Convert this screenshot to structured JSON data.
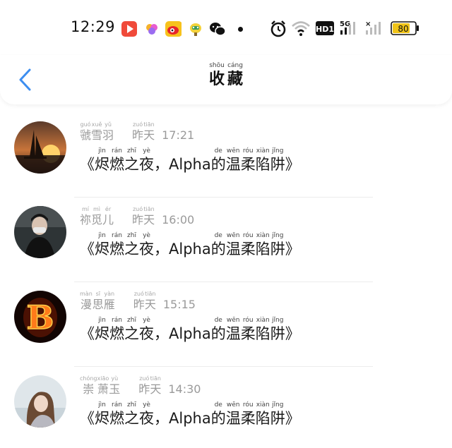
{
  "status_bar": {
    "time": "12:29",
    "signal_label": "5G",
    "hd_label": "HD1",
    "battery": "80",
    "icons": [
      "video-app-icon",
      "flower-app-icon",
      "weibo-icon",
      "bird-app-icon",
      "wechat-icon",
      "alarm-icon",
      "wifi-icon"
    ]
  },
  "header": {
    "title": [
      {
        "han": "收",
        "py": "shōu"
      },
      {
        "han": "藏",
        "py": "cáng"
      }
    ]
  },
  "items": [
    {
      "name": [
        {
          "han": "虢",
          "py": "guó"
        },
        {
          "han": "雪",
          "py": "xuě"
        },
        {
          "han": "羽",
          "py": "yǔ"
        }
      ],
      "day": [
        {
          "han": "昨",
          "py": "zuó"
        },
        {
          "han": "天",
          "py": "tiān"
        }
      ],
      "time": "17:21",
      "avatar": "sunset-sailboat-avatar"
    },
    {
      "name": [
        {
          "han": "祢",
          "py": "mí"
        },
        {
          "han": "觅",
          "py": "mì"
        },
        {
          "han": "儿",
          "py": "ér"
        }
      ],
      "day": [
        {
          "han": "昨",
          "py": "zuó"
        },
        {
          "han": "天",
          "py": "tiān"
        }
      ],
      "time": "16:00",
      "avatar": "masked-person-avatar"
    },
    {
      "name": [
        {
          "han": "漫",
          "py": "màn"
        },
        {
          "han": "思",
          "py": "sī"
        },
        {
          "han": "雁",
          "py": "yàn"
        }
      ],
      "day": [
        {
          "han": "昨",
          "py": "zuó"
        },
        {
          "han": "天",
          "py": "tiān"
        }
      ],
      "time": "15:15",
      "avatar": "fire-letter-b-avatar"
    },
    {
      "name": [
        {
          "han": "崇",
          "py": "chóng"
        },
        {
          "han": "萧",
          "py": "xiāo"
        },
        {
          "han": "玉",
          "py": "yù"
        }
      ],
      "day": [
        {
          "han": "昨",
          "py": "zuó"
        },
        {
          "han": "天",
          "py": "tiān"
        }
      ],
      "time": "14:30",
      "avatar": "girl-portrait-avatar"
    }
  ],
  "book_title": {
    "open": "《",
    "part1": [
      {
        "han": "烬",
        "py": "jìn"
      },
      {
        "han": "燃",
        "py": "rán"
      },
      {
        "han": "之",
        "py": "zhī"
      },
      {
        "han": "夜",
        "py": "yè"
      }
    ],
    "comma": "，",
    "latin": "Alpha",
    "part2": [
      {
        "han": "的",
        "py": "de"
      },
      {
        "han": "温",
        "py": "wēn"
      },
      {
        "han": "柔",
        "py": "róu"
      },
      {
        "han": "陷",
        "py": "xiàn"
      },
      {
        "han": "阱",
        "py": "jǐng"
      }
    ],
    "close": "》"
  },
  "colors": {
    "accent": "#3d8ef0",
    "meta": "#9a9a9a"
  }
}
